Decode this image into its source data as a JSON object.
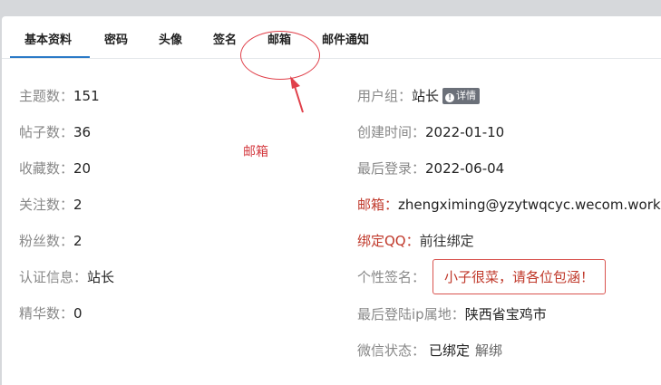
{
  "tabs": [
    {
      "label": "基本资料",
      "active": true
    },
    {
      "label": "密码",
      "active": false
    },
    {
      "label": "头像",
      "active": false
    },
    {
      "label": "签名",
      "active": false
    },
    {
      "label": "邮箱",
      "active": false
    },
    {
      "label": "邮件通知",
      "active": false
    }
  ],
  "annotation": {
    "text": "邮箱",
    "color": "#d43a40"
  },
  "left_stats": [
    {
      "label": "主题数：",
      "value": "151"
    },
    {
      "label": "帖子数：",
      "value": "36"
    },
    {
      "label": "收藏数：",
      "value": "20"
    },
    {
      "label": "关注数：",
      "value": "2"
    },
    {
      "label": "粉丝数：",
      "value": "2"
    },
    {
      "label": "认证信息：",
      "value": "站长"
    },
    {
      "label": "精华数：",
      "value": "0"
    }
  ],
  "right_info": {
    "group": {
      "label": "用户组：",
      "value": "站长",
      "badge": "详情",
      "badge_icon": "info-icon"
    },
    "created": {
      "label": "创建时间：",
      "value": "2022-01-10"
    },
    "last_login": {
      "label": "最后登录：",
      "value": "2022-06-04"
    },
    "email": {
      "label": "邮箱：",
      "value": "zhengximing@yzytwqcyc.wecom.work"
    },
    "qq": {
      "label": "绑定QQ：",
      "value": "前往绑定"
    },
    "signature": {
      "label": "个性签名：",
      "value": "小子很菜，请各位包涵！"
    },
    "ip_location": {
      "label": "最后登陆ip属地：",
      "value": "陕西省宝鸡市"
    },
    "wechat": {
      "label": "微信状态：",
      "value": "已绑定",
      "action": "解绑"
    }
  },
  "colors": {
    "accent": "#2a7ac7",
    "annotation_red": "#e0404a",
    "label_red": "#c0392b"
  }
}
